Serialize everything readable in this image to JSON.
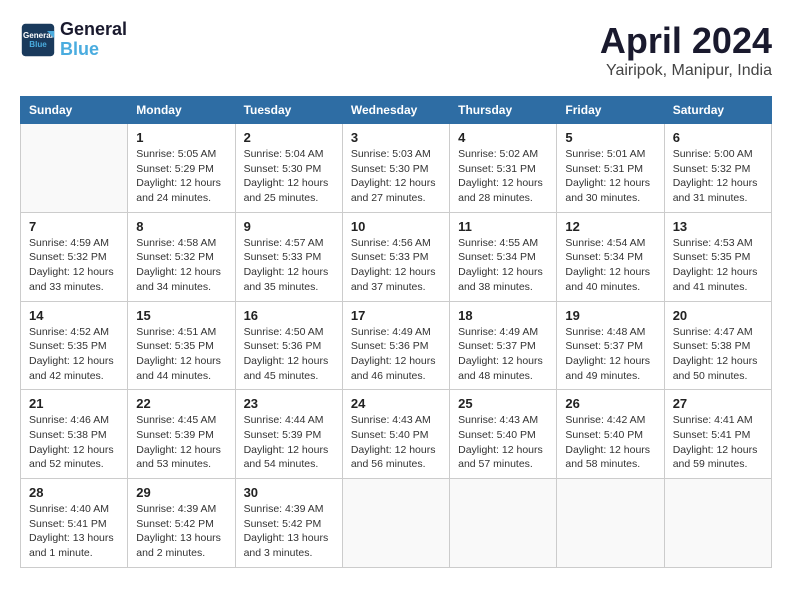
{
  "header": {
    "logo_line1": "General",
    "logo_line2": "Blue",
    "month": "April 2024",
    "location": "Yairipok, Manipur, India"
  },
  "days_of_week": [
    "Sunday",
    "Monday",
    "Tuesday",
    "Wednesday",
    "Thursday",
    "Friday",
    "Saturday"
  ],
  "weeks": [
    [
      {
        "day": "",
        "detail": ""
      },
      {
        "day": "1",
        "detail": "Sunrise: 5:05 AM\nSunset: 5:29 PM\nDaylight: 12 hours\nand 24 minutes."
      },
      {
        "day": "2",
        "detail": "Sunrise: 5:04 AM\nSunset: 5:30 PM\nDaylight: 12 hours\nand 25 minutes."
      },
      {
        "day": "3",
        "detail": "Sunrise: 5:03 AM\nSunset: 5:30 PM\nDaylight: 12 hours\nand 27 minutes."
      },
      {
        "day": "4",
        "detail": "Sunrise: 5:02 AM\nSunset: 5:31 PM\nDaylight: 12 hours\nand 28 minutes."
      },
      {
        "day": "5",
        "detail": "Sunrise: 5:01 AM\nSunset: 5:31 PM\nDaylight: 12 hours\nand 30 minutes."
      },
      {
        "day": "6",
        "detail": "Sunrise: 5:00 AM\nSunset: 5:32 PM\nDaylight: 12 hours\nand 31 minutes."
      }
    ],
    [
      {
        "day": "7",
        "detail": "Sunrise: 4:59 AM\nSunset: 5:32 PM\nDaylight: 12 hours\nand 33 minutes."
      },
      {
        "day": "8",
        "detail": "Sunrise: 4:58 AM\nSunset: 5:32 PM\nDaylight: 12 hours\nand 34 minutes."
      },
      {
        "day": "9",
        "detail": "Sunrise: 4:57 AM\nSunset: 5:33 PM\nDaylight: 12 hours\nand 35 minutes."
      },
      {
        "day": "10",
        "detail": "Sunrise: 4:56 AM\nSunset: 5:33 PM\nDaylight: 12 hours\nand 37 minutes."
      },
      {
        "day": "11",
        "detail": "Sunrise: 4:55 AM\nSunset: 5:34 PM\nDaylight: 12 hours\nand 38 minutes."
      },
      {
        "day": "12",
        "detail": "Sunrise: 4:54 AM\nSunset: 5:34 PM\nDaylight: 12 hours\nand 40 minutes."
      },
      {
        "day": "13",
        "detail": "Sunrise: 4:53 AM\nSunset: 5:35 PM\nDaylight: 12 hours\nand 41 minutes."
      }
    ],
    [
      {
        "day": "14",
        "detail": "Sunrise: 4:52 AM\nSunset: 5:35 PM\nDaylight: 12 hours\nand 42 minutes."
      },
      {
        "day": "15",
        "detail": "Sunrise: 4:51 AM\nSunset: 5:35 PM\nDaylight: 12 hours\nand 44 minutes."
      },
      {
        "day": "16",
        "detail": "Sunrise: 4:50 AM\nSunset: 5:36 PM\nDaylight: 12 hours\nand 45 minutes."
      },
      {
        "day": "17",
        "detail": "Sunrise: 4:49 AM\nSunset: 5:36 PM\nDaylight: 12 hours\nand 46 minutes."
      },
      {
        "day": "18",
        "detail": "Sunrise: 4:49 AM\nSunset: 5:37 PM\nDaylight: 12 hours\nand 48 minutes."
      },
      {
        "day": "19",
        "detail": "Sunrise: 4:48 AM\nSunset: 5:37 PM\nDaylight: 12 hours\nand 49 minutes."
      },
      {
        "day": "20",
        "detail": "Sunrise: 4:47 AM\nSunset: 5:38 PM\nDaylight: 12 hours\nand 50 minutes."
      }
    ],
    [
      {
        "day": "21",
        "detail": "Sunrise: 4:46 AM\nSunset: 5:38 PM\nDaylight: 12 hours\nand 52 minutes."
      },
      {
        "day": "22",
        "detail": "Sunrise: 4:45 AM\nSunset: 5:39 PM\nDaylight: 12 hours\nand 53 minutes."
      },
      {
        "day": "23",
        "detail": "Sunrise: 4:44 AM\nSunset: 5:39 PM\nDaylight: 12 hours\nand 54 minutes."
      },
      {
        "day": "24",
        "detail": "Sunrise: 4:43 AM\nSunset: 5:40 PM\nDaylight: 12 hours\nand 56 minutes."
      },
      {
        "day": "25",
        "detail": "Sunrise: 4:43 AM\nSunset: 5:40 PM\nDaylight: 12 hours\nand 57 minutes."
      },
      {
        "day": "26",
        "detail": "Sunrise: 4:42 AM\nSunset: 5:40 PM\nDaylight: 12 hours\nand 58 minutes."
      },
      {
        "day": "27",
        "detail": "Sunrise: 4:41 AM\nSunset: 5:41 PM\nDaylight: 12 hours\nand 59 minutes."
      }
    ],
    [
      {
        "day": "28",
        "detail": "Sunrise: 4:40 AM\nSunset: 5:41 PM\nDaylight: 13 hours\nand 1 minute."
      },
      {
        "day": "29",
        "detail": "Sunrise: 4:39 AM\nSunset: 5:42 PM\nDaylight: 13 hours\nand 2 minutes."
      },
      {
        "day": "30",
        "detail": "Sunrise: 4:39 AM\nSunset: 5:42 PM\nDaylight: 13 hours\nand 3 minutes."
      },
      {
        "day": "",
        "detail": ""
      },
      {
        "day": "",
        "detail": ""
      },
      {
        "day": "",
        "detail": ""
      },
      {
        "day": "",
        "detail": ""
      }
    ]
  ]
}
